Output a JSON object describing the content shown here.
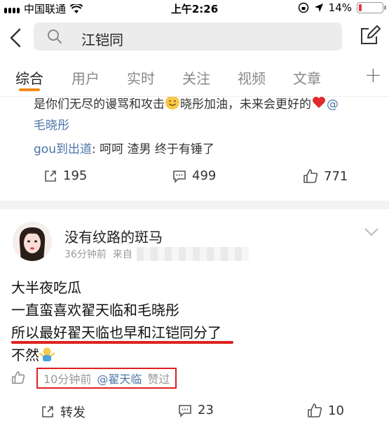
{
  "status_bar": {
    "carrier": "中国联通",
    "time": "上午2:26",
    "battery": "14%",
    "battery_level": 0.14
  },
  "search": {
    "query": "江铠同"
  },
  "tabs": [
    {
      "label": "综合",
      "active": true
    },
    {
      "label": "用户",
      "active": false
    },
    {
      "label": "实时",
      "active": false
    },
    {
      "label": "关注",
      "active": false
    },
    {
      "label": "视频",
      "active": false
    },
    {
      "label": "文章",
      "active": false
    }
  ],
  "post1": {
    "cut_line": "是你们无尽的谩骂和攻击",
    "cut_line_after_emoji": "晓彤加油，未来会更好的",
    "cut_mention": "@",
    "mention_name": "毛晓彤",
    "comment_user": "gou到出道",
    "comment_text": ": 呵呵 渣男 终于有锤了",
    "reposts": "195",
    "comments": "499",
    "likes": "771"
  },
  "post2": {
    "username": "没有纹路的斑马",
    "time": "36分钟前",
    "source_prefix": "来自",
    "lines": [
      "大半夜吃瓜",
      "一直蛮喜欢翟天临和毛晓彤",
      "所以最好翟天临也早和江铠同分了",
      "不然"
    ],
    "like_time": "10分钟前",
    "like_mention": "@翟天临",
    "like_status": "赞过",
    "repost_label": "转发",
    "comments": "23",
    "likes": "10"
  },
  "colors": {
    "accent": "#f28a17",
    "mention": "#4a76a8",
    "highlight": "#e02020"
  }
}
